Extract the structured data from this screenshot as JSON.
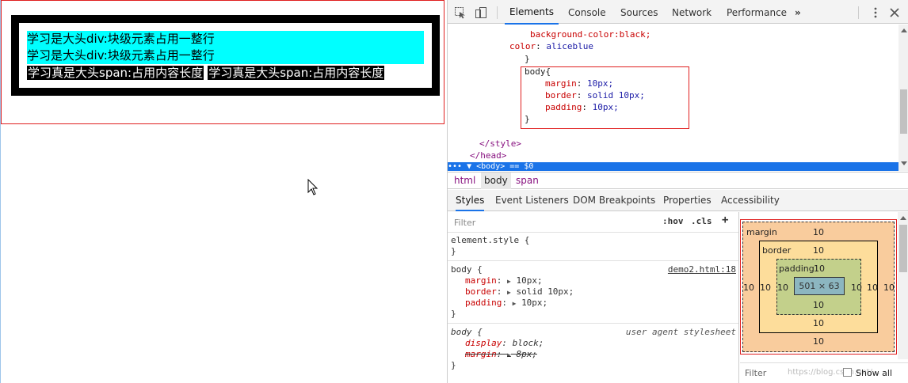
{
  "page": {
    "div_lines": [
      "学习是大头div:块级元素占用一整行",
      "学习是大头div:块级元素占用一整行"
    ],
    "span_items": [
      "学习真是大头span:占用内容长度",
      "学习真是大头span:占用内容长度"
    ]
  },
  "devtools": {
    "tabs": [
      "Elements",
      "Console",
      "Sources",
      "Network",
      "Performance"
    ],
    "active_tab": "Elements",
    "more_tabs": "»",
    "elements_code": {
      "line1": "background-color:black;",
      "line2_prop": "color",
      "line2_val": "aliceblue",
      "line3": "}",
      "line4": "body{",
      "line5_prop": "margin",
      "line5_val": "10px;",
      "line6_prop": "border",
      "line6_val": "solid 10px;",
      "line7_prop": "padding",
      "line7_val": "10px;",
      "line8": "}",
      "line9": "</style>",
      "line10": "</head>",
      "selected": "••• ▼ <body> == $0"
    },
    "breadcrumb": [
      "html",
      "body",
      "span"
    ],
    "subtabs": [
      "Styles",
      "Event Listeners",
      "DOM Breakpoints",
      "Properties",
      "Accessibility"
    ],
    "styles": {
      "filter_placeholder": "Filter",
      "hov": ":hov",
      "cls": ".cls",
      "plus": "+",
      "element_style": "element.style {",
      "close": "}",
      "body_selector": "body {",
      "body_source": "demo2.html:18",
      "body_props": [
        {
          "name": "margin",
          "value": "10px;"
        },
        {
          "name": "border",
          "value": "solid 10px;"
        },
        {
          "name": "padding",
          "value": "10px;"
        }
      ],
      "ua_selector": "body {",
      "ua_source": "user agent stylesheet",
      "ua_props": [
        {
          "name": "display",
          "value": "block;"
        },
        {
          "name": "margin",
          "value": "8px;"
        }
      ]
    },
    "box_model": {
      "margin_label": "margin",
      "border_label": "border",
      "padding_label": "padding",
      "margin": "10",
      "border": "10",
      "padding": "10",
      "content": "501 × 63"
    },
    "bottom_filter": "Filter",
    "show_all": "Show all",
    "watermark": "https://blog.csdn.net/..."
  }
}
